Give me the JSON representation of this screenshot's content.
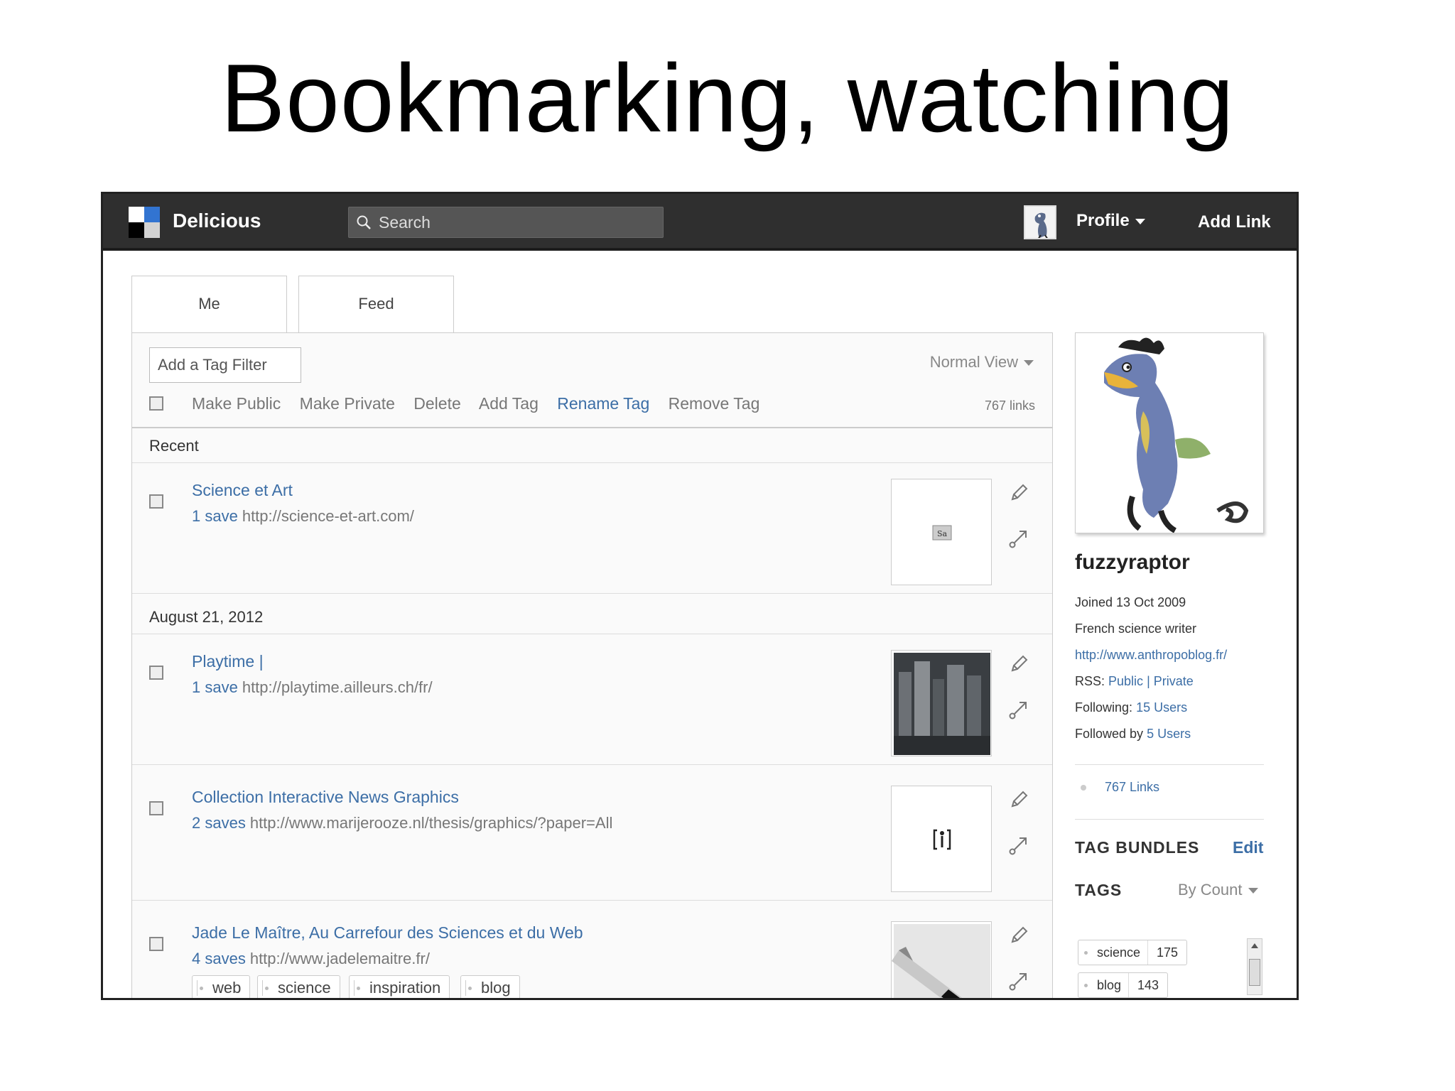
{
  "slide": {
    "title": "Bookmarking, watching"
  },
  "topbar": {
    "brand": "Delicious",
    "search_placeholder": "Search",
    "profile_label": "Profile",
    "add_link_label": "Add Link",
    "logo_colors": [
      "#000000",
      "#3274d1",
      "#d3d3d3",
      "#ffffff"
    ]
  },
  "tabs": [
    {
      "label": "Me"
    },
    {
      "label": "Feed"
    }
  ],
  "toolbar": {
    "tag_filter_placeholder": "Add a Tag Filter",
    "view_label": "Normal View",
    "actions": [
      "Make Public",
      "Make Private",
      "Delete",
      "Add Tag",
      "Rename Tag",
      "Remove Tag"
    ],
    "link_count": "767 links"
  },
  "sections": {
    "recent": "Recent",
    "date": "August 21, 2012"
  },
  "bookmarks": [
    {
      "title": "Science et Art",
      "saves": "1 save",
      "url": "http://science-et-art.com/",
      "tags": []
    },
    {
      "title": "Playtime |",
      "saves": "1 save",
      "url": "http://playtime.ailleurs.ch/fr/",
      "tags": []
    },
    {
      "title": "Collection Interactive News Graphics",
      "saves": "2 saves",
      "url": "http://www.marijerooze.nl/thesis/graphics/?paper=All",
      "tags": []
    },
    {
      "title": "Jade Le Maître, Au Carrefour des Sciences et du Web",
      "saves": "4 saves",
      "url": "http://www.jadelemaitre.fr/",
      "tags": [
        "web",
        "science",
        "inspiration",
        "blog"
      ]
    }
  ],
  "sidebar": {
    "username": "fuzzyraptor",
    "joined": "Joined 13 Oct 2009",
    "bio": "French science writer",
    "website": "http://www.anthropoblog.fr/",
    "rss_label": "RSS:",
    "rss_public": "Public",
    "rss_sep": "|",
    "rss_private": "Private",
    "following_label": "Following:",
    "following_value": "15 Users",
    "followed_label": "Followed by",
    "followed_value": "5 Users",
    "links_count": "767 Links",
    "tag_bundles_label": "TAG BUNDLES",
    "edit_label": "Edit",
    "tags_label": "TAGS",
    "sort_label": "By Count",
    "tags": [
      {
        "name": "science",
        "count": "175"
      },
      {
        "name": "blog",
        "count": "143"
      }
    ]
  }
}
